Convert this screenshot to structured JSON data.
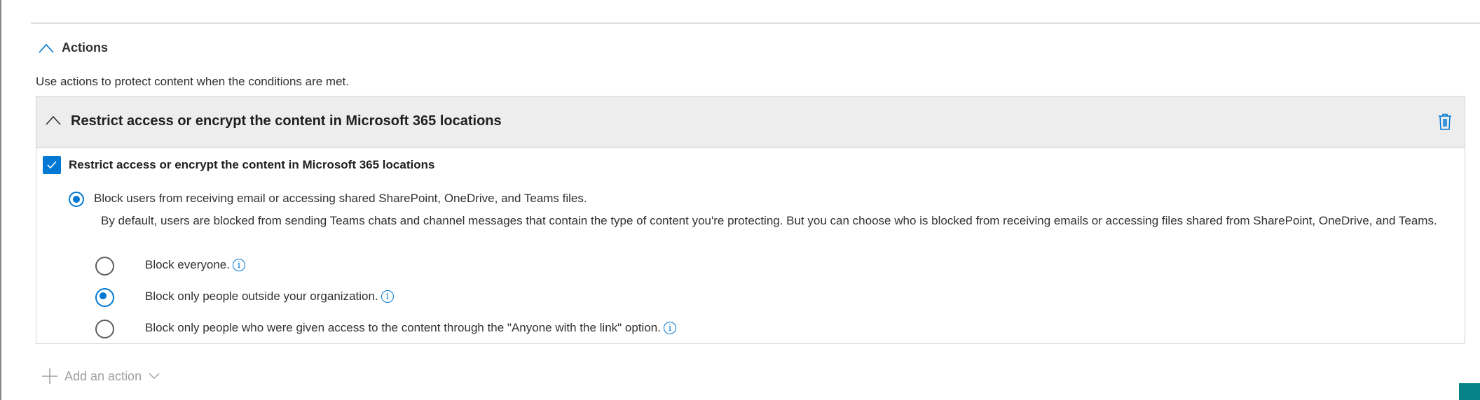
{
  "section": {
    "title": "Actions",
    "description": "Use actions to protect content when the conditions are met."
  },
  "action_card": {
    "title": "Restrict access or encrypt the content in Microsoft 365 locations",
    "checkbox_label": "Restrict access or encrypt the content in Microsoft 365 locations",
    "checkbox_checked": true,
    "block_option_label": "Block users from receiving email or accessing shared SharePoint, OneDrive, and Teams files.",
    "block_option_description": "By default, users are blocked from sending Teams chats and channel messages that contain the type of content you're protecting. But you can choose who is blocked from receiving emails or accessing files shared from SharePoint, OneDrive, and Teams.",
    "options": [
      {
        "label": "Block everyone.",
        "selected": false
      },
      {
        "label": "Block only people outside your organization.",
        "selected": true
      },
      {
        "label": "Block only people who were given access to the content through the \"Anyone with the link\" option.",
        "selected": false
      }
    ]
  },
  "add_action": {
    "label": "Add an action"
  },
  "colors": {
    "accent": "#0078d4",
    "teal": "#038387"
  }
}
